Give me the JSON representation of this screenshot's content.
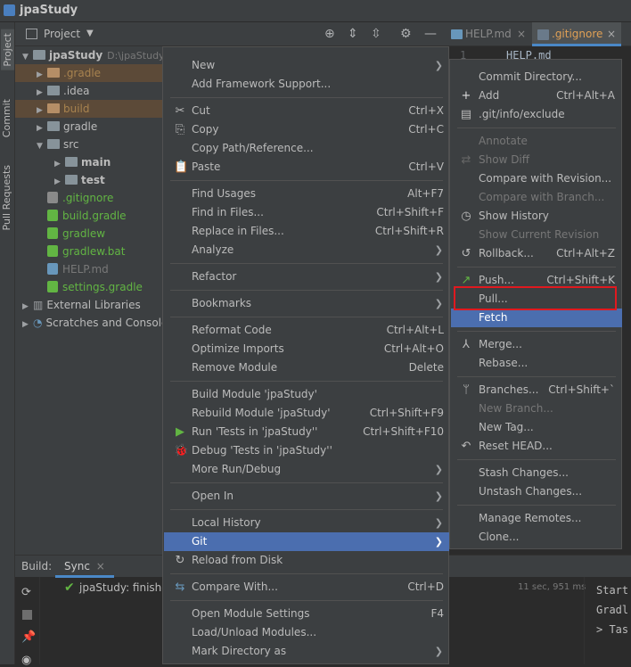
{
  "window": {
    "title": "jpaStudy"
  },
  "left_strip": {
    "project": "Project",
    "commit": "Commit",
    "pull_requests": "Pull Requests"
  },
  "project_panel": {
    "title": "Project",
    "tree": [
      {
        "label": "jpaStudy",
        "extra": "D:\\jpaStudy",
        "depth": 0,
        "expanded": true,
        "kind": "module"
      },
      {
        "label": ".gradle",
        "depth": 1,
        "kind": "folder-orange",
        "highlight": true
      },
      {
        "label": ".idea",
        "depth": 1,
        "kind": "folder"
      },
      {
        "label": "build",
        "depth": 1,
        "kind": "folder-orange",
        "highlight": true
      },
      {
        "label": "gradle",
        "depth": 1,
        "kind": "folder"
      },
      {
        "label": "src",
        "depth": 1,
        "kind": "folder",
        "expanded": true
      },
      {
        "label": "main",
        "depth": 2,
        "kind": "folder"
      },
      {
        "label": "test",
        "depth": 2,
        "kind": "folder"
      },
      {
        "label": ".gitignore",
        "depth": 1,
        "kind": "file"
      },
      {
        "label": "build.gradle",
        "depth": 1,
        "kind": "file"
      },
      {
        "label": "gradlew",
        "depth": 1,
        "kind": "file"
      },
      {
        "label": "gradlew.bat",
        "depth": 1,
        "kind": "file"
      },
      {
        "label": "HELP.md",
        "depth": 1,
        "kind": "file"
      },
      {
        "label": "settings.gradle",
        "depth": 1,
        "kind": "file"
      },
      {
        "label": "External Libraries",
        "depth": 0,
        "kind": "lib"
      },
      {
        "label": "Scratches and Consoles",
        "depth": 0,
        "kind": "scratch"
      }
    ]
  },
  "editor": {
    "tabs": [
      {
        "label": "HELP.md",
        "active": false
      },
      {
        "label": ".gitignore",
        "active": true
      }
    ],
    "line_number": "1",
    "first_line": "HELP.md"
  },
  "build": {
    "label": "Build:",
    "tab": "Sync",
    "status_text": "jpaStudy: finishe",
    "time": "11 sec, 951 ms",
    "console": [
      "Start",
      "Gradl",
      "> Tas"
    ]
  },
  "context_menu": [
    {
      "label": "New",
      "sub": true
    },
    {
      "label": "Add Framework Support..."
    },
    {
      "sep": true
    },
    {
      "label": "Cut",
      "shortcut": "Ctrl+X",
      "icon": "✂"
    },
    {
      "label": "Copy",
      "shortcut": "Ctrl+C",
      "icon": "⎘"
    },
    {
      "label": "Copy Path/Reference..."
    },
    {
      "label": "Paste",
      "shortcut": "Ctrl+V",
      "icon": "📋"
    },
    {
      "sep": true
    },
    {
      "label": "Find Usages",
      "shortcut": "Alt+F7"
    },
    {
      "label": "Find in Files...",
      "shortcut": "Ctrl+Shift+F"
    },
    {
      "label": "Replace in Files...",
      "shortcut": "Ctrl+Shift+R"
    },
    {
      "label": "Analyze",
      "sub": true
    },
    {
      "sep": true
    },
    {
      "label": "Refactor",
      "sub": true
    },
    {
      "sep": true
    },
    {
      "label": "Bookmarks",
      "sub": true
    },
    {
      "sep": true
    },
    {
      "label": "Reformat Code",
      "shortcut": "Ctrl+Alt+L"
    },
    {
      "label": "Optimize Imports",
      "shortcut": "Ctrl+Alt+O"
    },
    {
      "label": "Remove Module",
      "shortcut": "Delete"
    },
    {
      "sep": true
    },
    {
      "label": "Build Module 'jpaStudy'"
    },
    {
      "label": "Rebuild Module 'jpaStudy'",
      "shortcut": "Ctrl+Shift+F9"
    },
    {
      "label": "Run 'Tests in 'jpaStudy''",
      "shortcut": "Ctrl+Shift+F10",
      "icon": "▶"
    },
    {
      "label": "Debug 'Tests in 'jpaStudy''",
      "icon": "🐞"
    },
    {
      "label": "More Run/Debug",
      "sub": true
    },
    {
      "sep": true
    },
    {
      "label": "Open In",
      "sub": true
    },
    {
      "sep": true
    },
    {
      "label": "Local History",
      "sub": true
    },
    {
      "label": "Git",
      "sub": true,
      "active": true
    },
    {
      "label": "Reload from Disk",
      "icon": "↻"
    },
    {
      "sep": true
    },
    {
      "label": "Compare With...",
      "shortcut": "Ctrl+D",
      "icon": "⇆"
    },
    {
      "sep": true
    },
    {
      "label": "Open Module Settings",
      "shortcut": "F4"
    },
    {
      "label": "Load/Unload Modules..."
    },
    {
      "label": "Mark Directory as",
      "sub": true
    }
  ],
  "git_menu": [
    {
      "label": "Commit Directory..."
    },
    {
      "label": "Add",
      "shortcut": "Ctrl+Alt+A",
      "icon": "+"
    },
    {
      "label": ".git/info/exclude",
      "icon": "▤"
    },
    {
      "sep": true
    },
    {
      "label": "Annotate",
      "disabled": true
    },
    {
      "label": "Show Diff",
      "disabled": true,
      "icon": "⇄"
    },
    {
      "label": "Compare with Revision..."
    },
    {
      "label": "Compare with Branch...",
      "disabled": true
    },
    {
      "label": "Show History",
      "icon": "◷"
    },
    {
      "label": "Show Current Revision",
      "disabled": true
    },
    {
      "label": "Rollback...",
      "shortcut": "Ctrl+Alt+Z",
      "icon": "↺"
    },
    {
      "sep": true
    },
    {
      "label": "Push...",
      "shortcut": "Ctrl+Shift+K",
      "icon": "↗"
    },
    {
      "label": "Pull..."
    },
    {
      "label": "Fetch",
      "active": true
    },
    {
      "sep": true
    },
    {
      "label": "Merge...",
      "icon": "⅄"
    },
    {
      "label": "Rebase..."
    },
    {
      "sep": true
    },
    {
      "label": "Branches...",
      "shortcut": "Ctrl+Shift+`",
      "icon": "ᛘ"
    },
    {
      "label": "New Branch...",
      "disabled": true
    },
    {
      "label": "New Tag..."
    },
    {
      "label": "Reset HEAD...",
      "icon": "↶"
    },
    {
      "sep": true
    },
    {
      "label": "Stash Changes..."
    },
    {
      "label": "Unstash Changes..."
    },
    {
      "sep": true
    },
    {
      "label": "Manage Remotes..."
    },
    {
      "label": "Clone..."
    }
  ],
  "colors": {
    "accent": "#4b6eaf",
    "highlight_box": "#e0191f",
    "gradle_green": "#62b543"
  }
}
